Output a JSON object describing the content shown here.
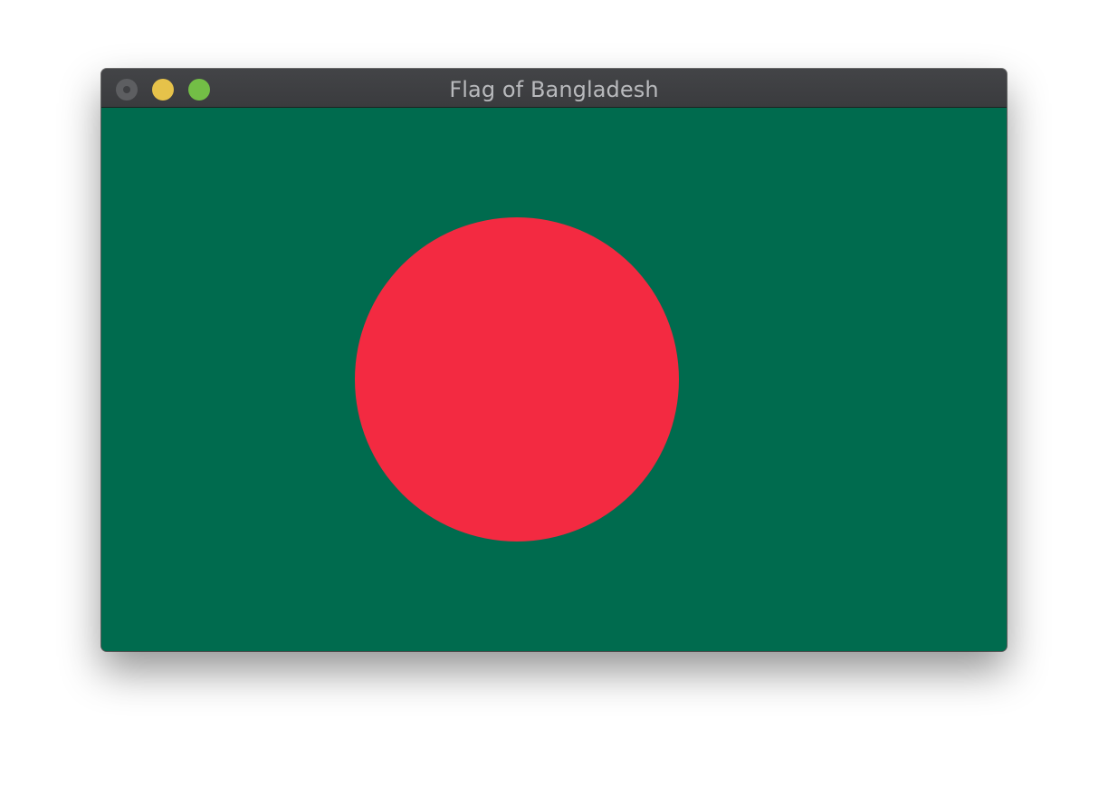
{
  "window": {
    "title": "Flag of Bangladesh"
  },
  "flag": {
    "name": "Bangladesh",
    "field_color": "#006b4e",
    "disc_color": "#f32a41"
  },
  "colors": {
    "titlebar": "#3d3e41",
    "title_text": "#b9babd",
    "close_button": "#5d5e61",
    "minimize_button": "#e6c24a",
    "zoom_button": "#73be46"
  },
  "icons": {
    "close": "close-icon",
    "minimize": "minimize-icon",
    "zoom": "zoom-icon"
  }
}
